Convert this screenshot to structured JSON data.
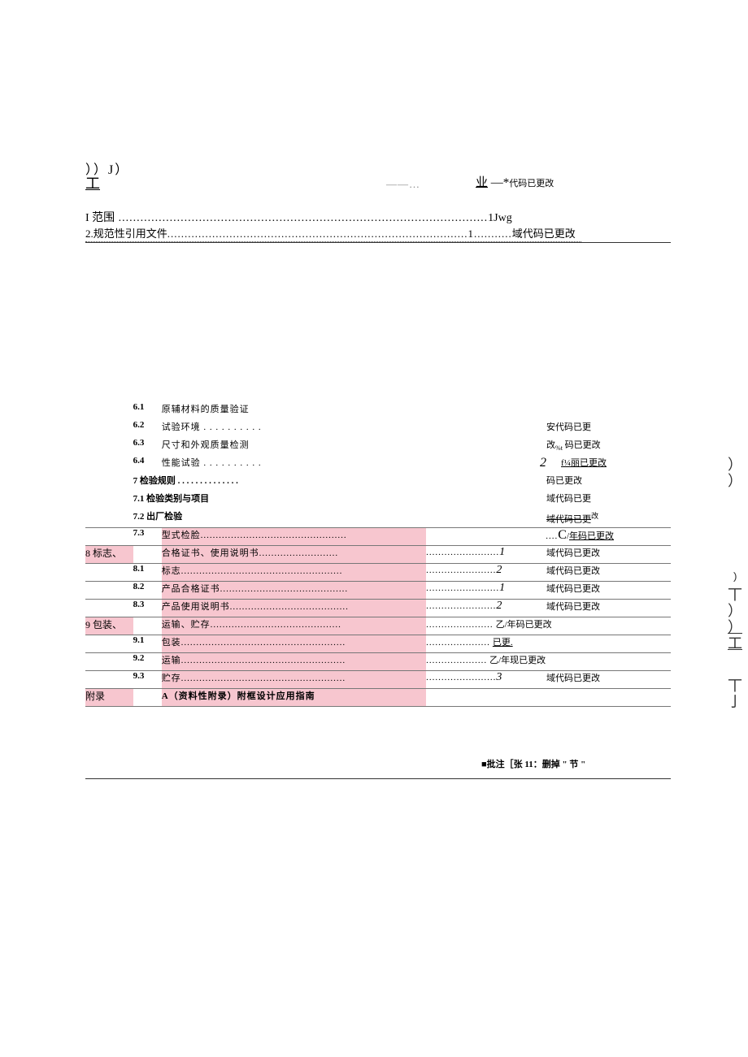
{
  "top": {
    "jj": "））J）",
    "gong": "工",
    "dashes": "——…",
    "ye_underline": "业",
    "ye_dash": " —*",
    "ye_tail": "代码已更改"
  },
  "line_i": {
    "label": "I 范围",
    "dots": " .....................................................................................................",
    "page": "1",
    "note": "Jwg"
  },
  "line_2": {
    "label": "2.规范性引用文件",
    "dots": ".......................................................................................1...........",
    "note": "域代码已更改"
  },
  "rows": [
    {
      "left": "",
      "num": "6.1",
      "title": "原辅材料的质量验证",
      "mid": "",
      "right": "",
      "pink": false,
      "border": false
    },
    {
      "left": "",
      "num": "6.2",
      "title": "试验环境 . . . . . . . . . .",
      "mid": "",
      "right": "安代码已更",
      "pink": false,
      "border": false
    },
    {
      "left": "",
      "num": "6.3",
      "title": "尺寸和外观质量检测",
      "mid": "",
      "right_pre": "改",
      "right_sub": "%t",
      "right_tail": " 码已更改",
      "pink": false,
      "border": false,
      "special_63": true
    },
    {
      "left": "",
      "num": "6.4",
      "title": "性能试验 . . . . . . . . . .",
      "mid_big": "2",
      "right_ul": "f¼丽已更改",
      "pink": false,
      "border": false,
      "special_64": true
    },
    {
      "left": "",
      "num": "",
      "title_prefix": "7 检验规则 . . . . . . . . . . . . . .",
      "mid": "",
      "right": "码已更改",
      "pink": false,
      "border": false,
      "fullspan": true
    },
    {
      "left": "",
      "num": "",
      "title_prefix": "7.1 检验类别与项目",
      "mid": "",
      "right": "域代码已更",
      "pink": false,
      "border": false,
      "fullspan": true
    },
    {
      "left": "",
      "num": "",
      "title_prefix": "7.2 出厂检验",
      "mid": "",
      "right_strike": "域代码已更",
      "right_sup": "改",
      "pink": false,
      "border": true,
      "fullspan": true,
      "special_72": true
    },
    {
      "left": "",
      "num": "7.3",
      "title": "型式检脸................................................",
      "mid": "",
      "right_pre": "....",
      "right_big": "C",
      "right_tail": "/年码已更改",
      "pink": true,
      "border": true,
      "title_pink": true,
      "mid_merge": true,
      "special_73": true
    },
    {
      "left": "8 标志、",
      "num": "",
      "title": "合格证书、使用说明书..........................",
      "mid": "........................",
      "mid_num": "1",
      "right": "域代码已更改",
      "pink": true,
      "border": true,
      "left_pink": true,
      "title_pink": true,
      "hasnum": true
    },
    {
      "left": "",
      "num": "8.1",
      "title": "标志.....................................................",
      "mid": ".......................",
      "mid_num": "2",
      "right": "域代码已更改",
      "pink": true,
      "border": true,
      "title_pink": true,
      "hasnum": true
    },
    {
      "left": "",
      "num": "8.2",
      "title": "产品合格证书..........................................",
      "mid": "........................",
      "mid_num": "1",
      "right": "域代码已更改",
      "pink": true,
      "border": true,
      "title_pink": true,
      "hasnum": true
    },
    {
      "left": "",
      "num": "8.3",
      "title": "产品使用说明书.......................................",
      "mid": ".......................",
      "mid_num": "2",
      "right": "域代码已更改",
      "pink": true,
      "border": true,
      "title_pink": true,
      "hasnum": true
    },
    {
      "left": "9 包装、",
      "num": "",
      "title": "运输、贮存...........................................",
      "mid": "......................",
      "mid_tail": "乙/年码已更改",
      "right": "",
      "pink": true,
      "border": true,
      "left_pink": true,
      "title_pink": true,
      "mid_merge": true
    },
    {
      "left": "",
      "num": "9.1",
      "title": "包装......................................................",
      "mid": ".....................",
      "mid_tail_ul": "已更.",
      "right": "",
      "pink": true,
      "border": true,
      "title_pink": true,
      "mid_merge": true,
      "special_91": true
    },
    {
      "left": "",
      "num": "9.2",
      "title": "运输......................................................",
      "mid": "....................",
      "mid_tail": "乙/年现已更改",
      "right": "",
      "pink": true,
      "border": true,
      "title_pink": true,
      "mid_merge": true
    },
    {
      "left": "",
      "num": "9.3",
      "title": "贮存......................................................",
      "mid": ".......................",
      "mid_num": "3",
      "right": "域代码已更改",
      "pink": true,
      "border": true,
      "title_pink": true,
      "hasnum": true
    },
    {
      "left": "附录",
      "num": "",
      "title": "A（资料性附录）附框设计应用指南",
      "mid": "",
      "right": "",
      "pink": true,
      "border": true,
      "title_pink": true,
      "title_bold": true,
      "left_pink": true
    }
  ],
  "edge": {
    "r1": "）",
    "r1b": "）",
    "r2": "﹚",
    "r3": "丅",
    "r4": "）",
    "r5": "）",
    "r6": "工",
    "r7": "丅",
    "r7b": "亅"
  },
  "comment": "■批注［张 11：删掉 \" 节 \""
}
